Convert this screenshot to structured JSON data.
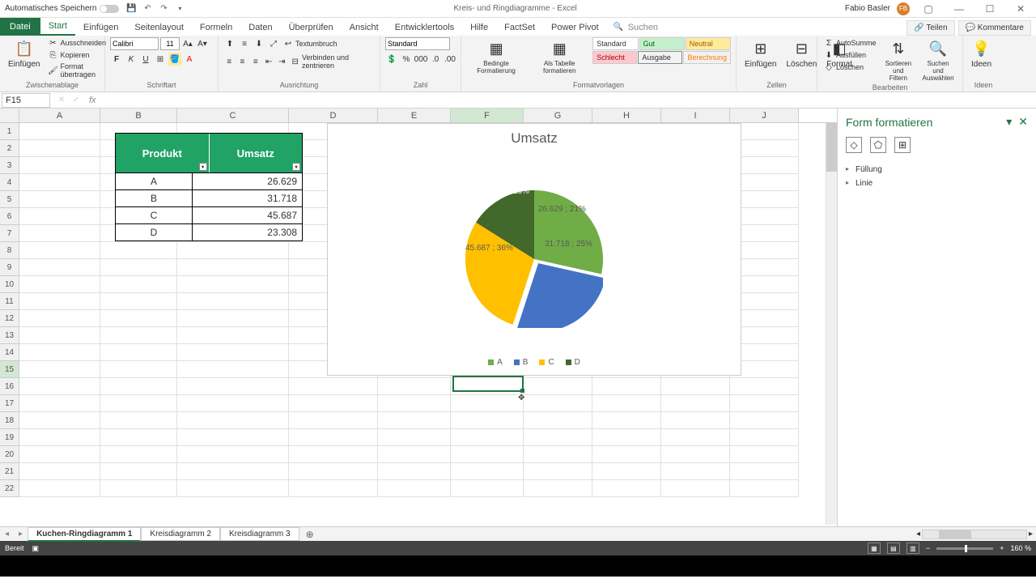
{
  "titlebar": {
    "autosave": "Automatisches Speichern",
    "doc_title": "Kreis- und Ringdiagramme - Excel",
    "user": "Fabio Basler",
    "user_initials": "FB"
  },
  "tabs": {
    "file": "Datei",
    "list": [
      "Start",
      "Einfügen",
      "Seitenlayout",
      "Formeln",
      "Daten",
      "Überprüfen",
      "Ansicht",
      "Entwicklertools",
      "Hilfe",
      "FactSet",
      "Power Pivot"
    ],
    "search": "Suchen",
    "share": "Teilen",
    "comments": "Kommentare"
  },
  "ribbon": {
    "paste": "Einfügen",
    "cut": "Ausschneiden",
    "copy": "Kopieren",
    "format_painter": "Format übertragen",
    "g_clipboard": "Zwischenablage",
    "font_name": "Calibri",
    "font_size": "11",
    "g_font": "Schriftart",
    "wrap": "Textumbruch",
    "merge": "Verbinden und zentrieren",
    "g_align": "Ausrichtung",
    "num_format": "Standard",
    "g_number": "Zahl",
    "cond_fmt": "Bedingte Formatierung",
    "as_table": "Als Tabelle formatieren",
    "styles": {
      "standard": "Standard",
      "gut": "Gut",
      "neutral": "Neutral",
      "schlecht": "Schlecht",
      "ausgabe": "Ausgabe",
      "berechnung": "Berechnung"
    },
    "g_styles": "Formatvorlagen",
    "insert": "Einfügen",
    "delete": "Löschen",
    "format": "Format",
    "g_cells": "Zellen",
    "autosum": "AutoSumme",
    "fill": "Ausfüllen",
    "clear": "Löschen",
    "sort": "Sortieren und Filtern",
    "find": "Suchen und Auswählen",
    "g_edit": "Bearbeiten",
    "ideas": "Ideen",
    "g_ideas": "Ideen"
  },
  "namebox": "F15",
  "columns": [
    "A",
    "B",
    "C",
    "D",
    "E",
    "F",
    "G",
    "H",
    "I",
    "J"
  ],
  "selected_col": "F",
  "selected_row": 15,
  "table": {
    "h1": "Produkt",
    "h2": "Umsatz",
    "rows": [
      {
        "p": "A",
        "u": "26.629"
      },
      {
        "p": "B",
        "u": "31.718"
      },
      {
        "p": "C",
        "u": "45.687"
      },
      {
        "p": "D",
        "u": "23.308"
      }
    ]
  },
  "chart_data": {
    "type": "pie",
    "title": "Umsatz",
    "categories": [
      "A",
      "B",
      "C",
      "D"
    ],
    "values": [
      26629,
      31718,
      45687,
      23308
    ],
    "percentages": [
      21,
      25,
      36,
      18
    ],
    "colors": [
      "#70ad47",
      "#4472c4",
      "#ffc000",
      "#43682b"
    ],
    "segment_labels": [
      "26.629 ; 21%",
      "31.718 ; 25%",
      "45.687 ; 36%",
      "23.308 ; 18%"
    ]
  },
  "side_panel": {
    "title": "Form formatieren",
    "items": [
      "Füllung",
      "Linie"
    ]
  },
  "sheets": {
    "list": [
      "Kuchen-Ringdiagramm 1",
      "Kreisdiagramm 2",
      "Kreisdiagramm 3"
    ],
    "active": 0
  },
  "statusbar": {
    "ready": "Bereit",
    "zoom": "160 %"
  }
}
